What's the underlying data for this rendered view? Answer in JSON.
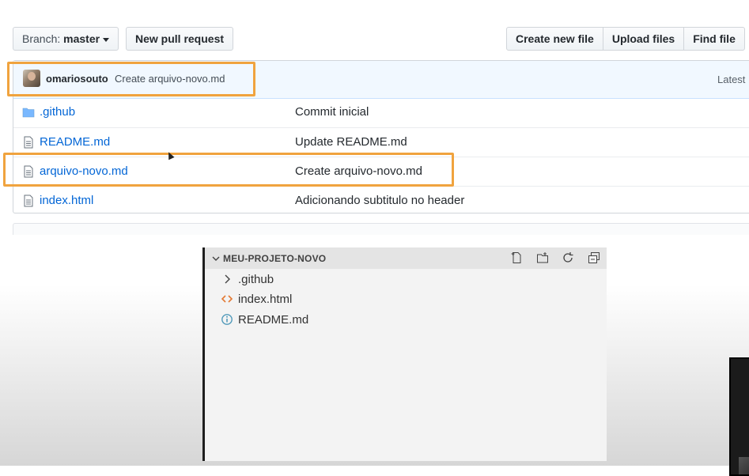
{
  "toolbar": {
    "branch_prefix": "Branch:",
    "branch_name": "master",
    "new_pull_request": "New pull request",
    "create_new_file": "Create new file",
    "upload_files": "Upload files",
    "find_file": "Find file"
  },
  "latest_commit": {
    "author": "omariosouto",
    "message": "Create arquivo-novo.md",
    "latest_label": "Latest"
  },
  "files": [
    {
      "name": ".github",
      "message": "Commit inicial",
      "icon": "folder-icon"
    },
    {
      "name": "README.md",
      "message": "Update README.md",
      "icon": "file-icon"
    },
    {
      "name": "arquivo-novo.md",
      "message": "Create arquivo-novo.md",
      "icon": "file-icon"
    },
    {
      "name": "index.html",
      "message": "Adicionando subtitulo no header",
      "icon": "file-icon"
    }
  ],
  "explorer": {
    "title": "MEU-PROJETO-NOVO",
    "items": [
      {
        "label": ".github",
        "icon": "chevron-right-icon"
      },
      {
        "label": "index.html",
        "icon": "html-icon"
      },
      {
        "label": "README.md",
        "icon": "info-icon"
      }
    ]
  },
  "colors": {
    "highlight": "#f0a33e",
    "link": "#0366d6",
    "commit_bar": "#f1f8ff"
  }
}
